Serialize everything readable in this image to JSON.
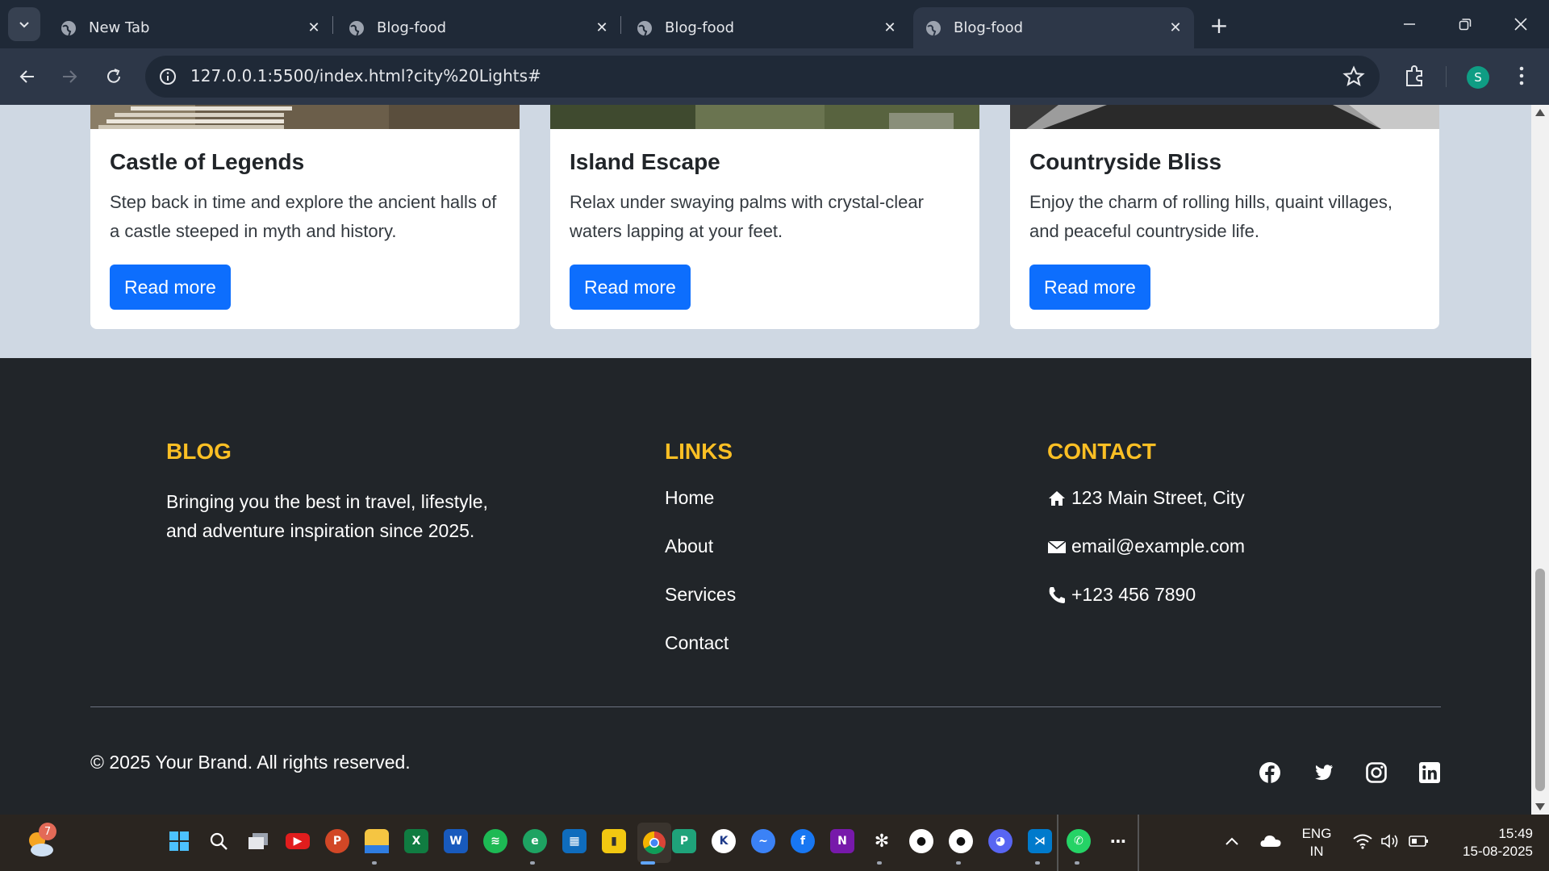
{
  "browser": {
    "tabs": [
      {
        "title": "New Tab",
        "active": false
      },
      {
        "title": "Blog-food",
        "active": false
      },
      {
        "title": "Blog-food",
        "active": false
      },
      {
        "title": "Blog-food",
        "active": true
      }
    ],
    "url": "127.0.0.1:5500/index.html?city%20Lights#",
    "profile_initial": "S"
  },
  "cards": [
    {
      "title": "Castle of Legends",
      "text": "Step back in time and explore the ancient halls of a castle steeped in myth and history.",
      "button": "Read more"
    },
    {
      "title": "Island Escape",
      "text": "Relax under swaying palms with crystal-clear waters lapping at your feet.",
      "button": "Read more"
    },
    {
      "title": "Countryside Bliss",
      "text": "Enjoy the charm of rolling hills, quaint villages, and peaceful countryside life.",
      "button": "Read more"
    }
  ],
  "footer": {
    "blog_heading": "BLOG",
    "blog_text": "Bringing you the best in travel, lifestyle, and adventure inspiration since 2025.",
    "links_heading": "LINKS",
    "links": [
      "Home",
      "About",
      "Services",
      "Contact"
    ],
    "contact_heading": "CONTACT",
    "address": "123 Main Street, City",
    "email": "email@example.com",
    "phone": "+123 456 7890",
    "copyright": "© 2025 Your Brand. All rights reserved.",
    "social_icons": [
      "facebook-icon",
      "twitter-icon",
      "instagram-icon",
      "linkedin-icon"
    ]
  },
  "colors": {
    "accent": "#fbbf24",
    "button": "#0d6efd",
    "footer_bg": "#212529",
    "page_bg": "#cfd8e3"
  },
  "taskbar": {
    "weather_badge": "7",
    "language_line1": "ENG",
    "language_line2": "IN",
    "time": "15:49",
    "date": "15-08-2025"
  }
}
